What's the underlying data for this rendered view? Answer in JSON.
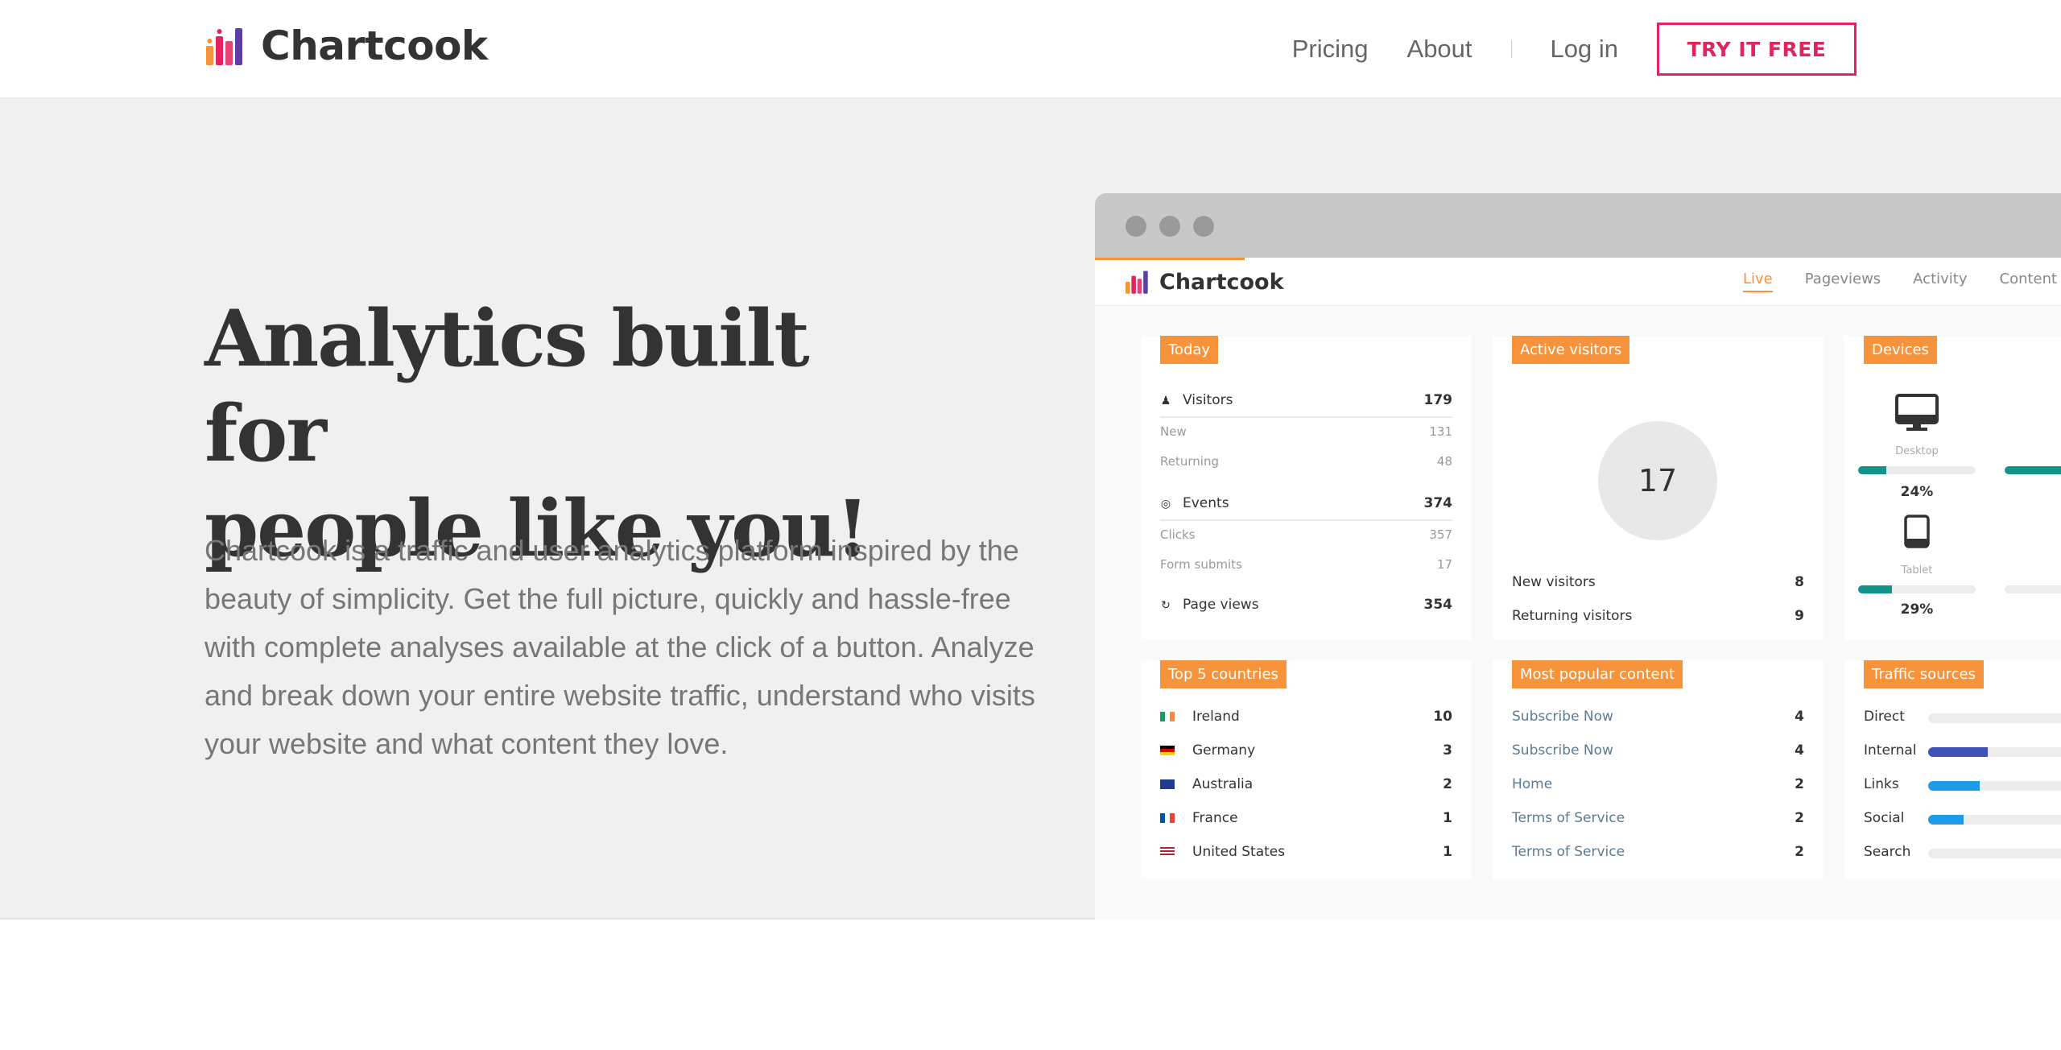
{
  "nav": {
    "brand": "Chartcook",
    "links": [
      "Pricing",
      "About"
    ],
    "login": "Log in",
    "cta": "TRY IT FREE"
  },
  "hero": {
    "headline_line1": "Analytics built for",
    "headline_line2": "people like you!",
    "lead": "Chartcook is a traffic and user analytics platform inspired by the beauty of simplicity. Get the full picture, quickly and hassle-free with complete analyses available at the click of a button. Analyze and break down your entire website traffic, understand who visits your website and what content they love."
  },
  "app": {
    "brand": "Chartcook",
    "tabs": [
      "Live",
      "Pageviews",
      "Activity",
      "Content"
    ],
    "active_tab": "Live",
    "today": {
      "tag": "Today",
      "visitors_label": "Visitors",
      "visitors": "179",
      "new_label": "New",
      "new": "131",
      "returning_label": "Returning",
      "returning": "48",
      "events_label": "Events",
      "events": "374",
      "clicks_label": "Clicks",
      "clicks": "357",
      "forms_label": "Form submits",
      "forms": "17",
      "pageviews_label": "Page views",
      "pageviews": "354"
    },
    "active": {
      "tag": "Active visitors",
      "count": "17",
      "new_label": "New visitors",
      "new": "8",
      "returning_label": "Returning visitors",
      "returning": "9"
    },
    "devices": {
      "tag": "Devices",
      "items": [
        {
          "label": "Desktop",
          "pct_text": "24%",
          "pct": 0.24
        },
        {
          "label": "Tablet",
          "pct_text": "29%",
          "pct": 0.29
        }
      ]
    },
    "countries": {
      "tag": "Top 5 countries",
      "rows": [
        {
          "name": "Ireland",
          "value": "10"
        },
        {
          "name": "Germany",
          "value": "3"
        },
        {
          "name": "Australia",
          "value": "2"
        },
        {
          "name": "France",
          "value": "1"
        },
        {
          "name": "United States",
          "value": "1"
        }
      ]
    },
    "content": {
      "tag": "Most popular content",
      "rows": [
        {
          "name": "Subscribe Now",
          "value": "4"
        },
        {
          "name": "Subscribe Now",
          "value": "4"
        },
        {
          "name": "Home",
          "value": "2"
        },
        {
          "name": "Terms of Service",
          "value": "2"
        },
        {
          "name": "Terms of Service",
          "value": "2"
        }
      ]
    },
    "sources": {
      "tag": "Traffic sources",
      "rows": [
        {
          "name": "Direct",
          "level": 0.0,
          "color": "#3f51b5"
        },
        {
          "name": "Internal",
          "level": 0.37,
          "color": "#3f51b5"
        },
        {
          "name": "Links",
          "level": 0.32,
          "color": "#1e9be8"
        },
        {
          "name": "Social",
          "level": 0.22,
          "color": "#1e9be8"
        },
        {
          "name": "Search",
          "level": 0.0,
          "color": "#1e9be8"
        }
      ]
    },
    "colors": {
      "accent": "#f7933b",
      "cta": "#e0245e",
      "device_bar": "#14938a"
    }
  }
}
